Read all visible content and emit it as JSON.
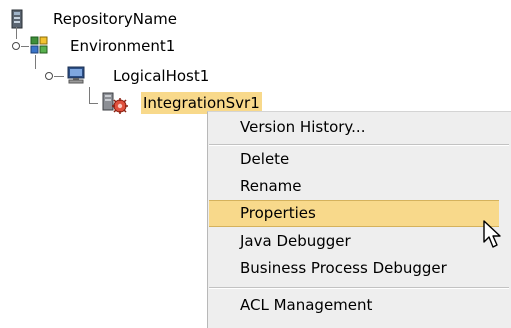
{
  "tree": {
    "repository": {
      "label": "RepositoryName",
      "icon": "repository-icon"
    },
    "environment": {
      "label": "Environment1",
      "icon": "environment-icon"
    },
    "logical_host": {
      "label": "LogicalHost1",
      "icon": "logical-host-icon"
    },
    "integration_server": {
      "label": "IntegrationSvr1",
      "icon": "integration-server-icon",
      "highlight_color": "#f8d98b"
    }
  },
  "context_menu": {
    "items": [
      {
        "label": "Version History..."
      },
      {
        "label": "Delete"
      },
      {
        "label": "Rename"
      },
      {
        "label": "Properties",
        "selected": true
      },
      {
        "label": "Java Debugger"
      },
      {
        "label": "Business Process Debugger"
      },
      {
        "label": "ACL Management"
      }
    ],
    "selected_color": "#f8d98b",
    "background_color": "#eeeeee"
  }
}
